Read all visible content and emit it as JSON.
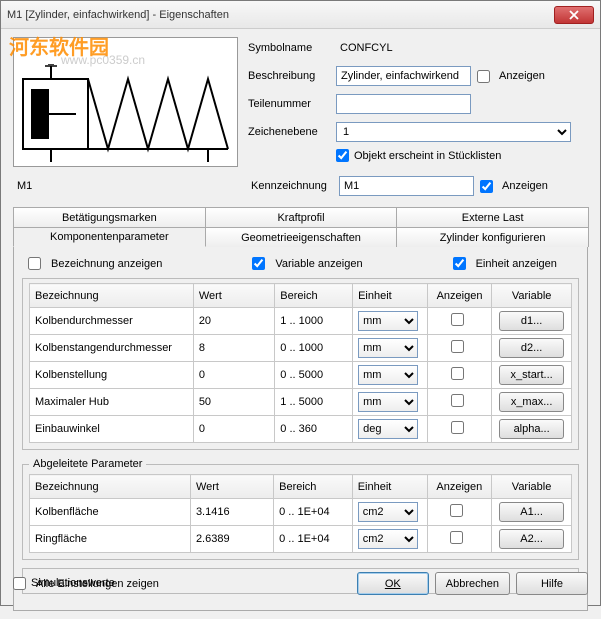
{
  "title": "M1  [Zylinder, einfachwirkend] - Eigenschaften",
  "watermark": "河东软件园",
  "watermark_url": "www.pc0359.cn",
  "props": {
    "symbolname_label": "Symbolname",
    "symbolname_value": "CONFCYL",
    "beschreibung_label": "Beschreibung",
    "beschreibung_value": "Zylinder, einfachwirkend",
    "anzeigen_label": "Anzeigen",
    "teilenummer_label": "Teilenummer",
    "teilenummer_value": "",
    "zeichenebene_label": "Zeichenebene",
    "zeichenebene_value": "1",
    "stuecklisten_label": "Objekt erscheint in Stücklisten",
    "m1_label": "M1",
    "kennzeichnung_label": "Kennzeichnung",
    "kennzeichnung_value": "M1"
  },
  "tabs": {
    "row1": [
      "Betätigungsmarken",
      "Kraftprofil",
      "Externe Last"
    ],
    "row2": [
      "Komponentenparameter",
      "Geometrieeigenschaften",
      "Zylinder konfigurieren"
    ]
  },
  "options": {
    "bez_anzeigen": "Bezeichnung anzeigen",
    "var_anzeigen": "Variable anzeigen",
    "einh_anzeigen": "Einheit anzeigen"
  },
  "grid": {
    "headers": {
      "bezeichnung": "Bezeichnung",
      "wert": "Wert",
      "bereich": "Bereich",
      "einheit": "Einheit",
      "anzeigen": "Anzeigen",
      "variable": "Variable"
    },
    "rows": [
      {
        "bez": "Kolbendurchmesser",
        "wert": "20",
        "bereich": "1 .. 1000",
        "einheit": "mm",
        "var": "d1..."
      },
      {
        "bez": "Kolbenstangendurchmesser",
        "wert": "8",
        "bereich": "0 .. 1000",
        "einheit": "mm",
        "var": "d2..."
      },
      {
        "bez": "Kolbenstellung",
        "wert": "0",
        "bereich": "0 .. 5000",
        "einheit": "mm",
        "var": "x_start..."
      },
      {
        "bez": "Maximaler Hub",
        "wert": "50",
        "bereich": "1 .. 5000",
        "einheit": "mm",
        "var": "x_max..."
      },
      {
        "bez": "Einbauwinkel",
        "wert": "0",
        "bereich": "0 .. 360",
        "einheit": "deg",
        "var": "alpha..."
      }
    ]
  },
  "derived": {
    "legend": "Abgeleitete Parameter",
    "rows": [
      {
        "bez": "Kolbenfläche",
        "wert": "3.1416",
        "bereich": "0 .. 1E+04",
        "einheit": "cm2",
        "var": "A1..."
      },
      {
        "bez": "Ringfläche",
        "wert": "2.6389",
        "bereich": "0 .. 1E+04",
        "einheit": "cm2",
        "var": "A2..."
      }
    ]
  },
  "simulationswerte": "Simulationswerte",
  "footer": {
    "alle_einst": "Alle Einstellungen zeigen",
    "ok": "OK",
    "abbrechen": "Abbrechen",
    "hilfe": "Hilfe"
  }
}
